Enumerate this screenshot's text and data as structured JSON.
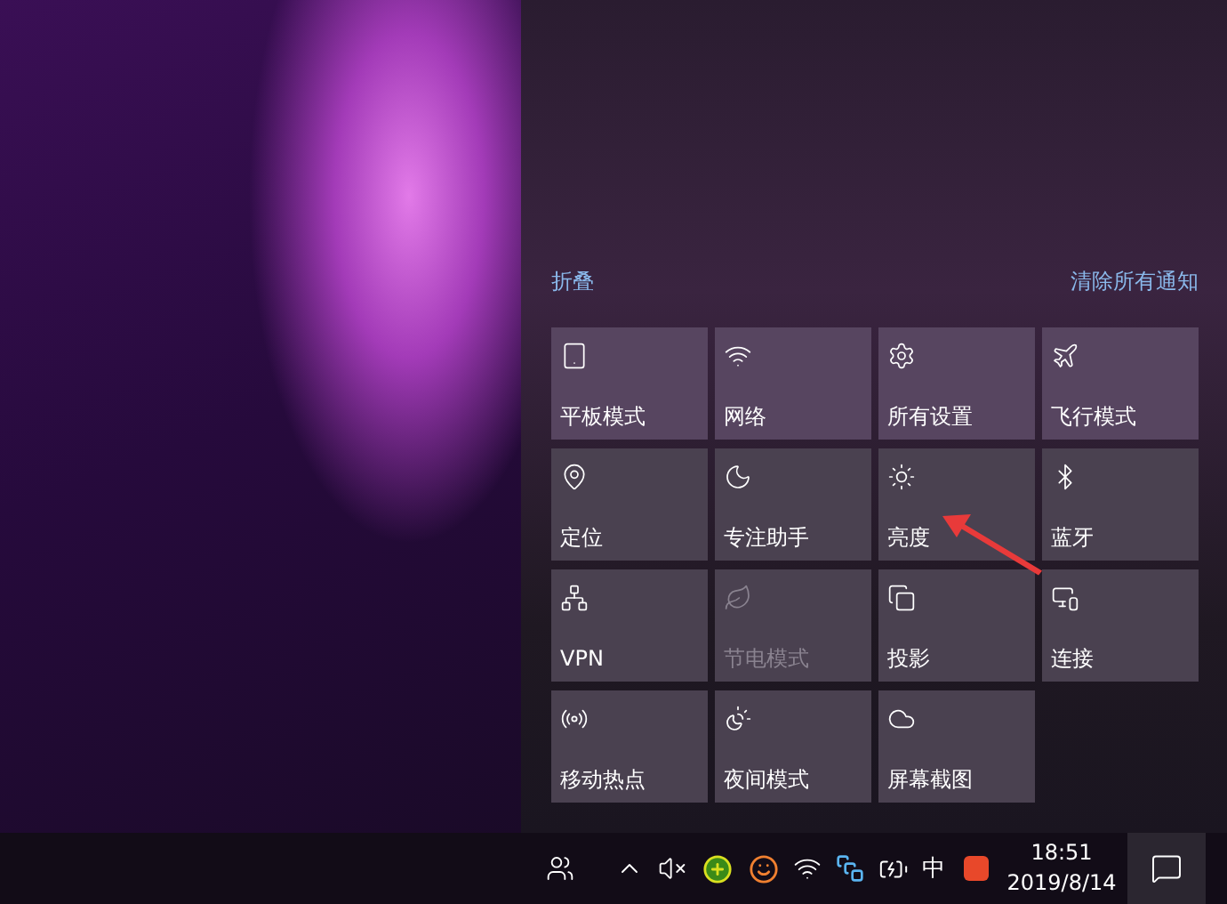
{
  "action_center": {
    "collapse_label": "折叠",
    "clear_label": "清除所有通知",
    "tiles": [
      {
        "label": "平板模式",
        "disabled": false
      },
      {
        "label": "网络",
        "disabled": false
      },
      {
        "label": "所有设置",
        "disabled": false
      },
      {
        "label": "飞行模式",
        "disabled": false
      },
      {
        "label": "定位",
        "disabled": false
      },
      {
        "label": "专注助手",
        "disabled": false
      },
      {
        "label": "亮度",
        "disabled": false
      },
      {
        "label": "蓝牙",
        "disabled": false
      },
      {
        "label": "VPN",
        "disabled": false
      },
      {
        "label": "节电模式",
        "disabled": true
      },
      {
        "label": "投影",
        "disabled": false
      },
      {
        "label": "连接",
        "disabled": false
      },
      {
        "label": "移动热点",
        "disabled": false
      },
      {
        "label": "夜间模式",
        "disabled": false
      },
      {
        "label": "屏幕截图",
        "disabled": false
      }
    ]
  },
  "taskbar": {
    "input_method": "中",
    "time": "18:51",
    "date": "2019/8/14"
  }
}
